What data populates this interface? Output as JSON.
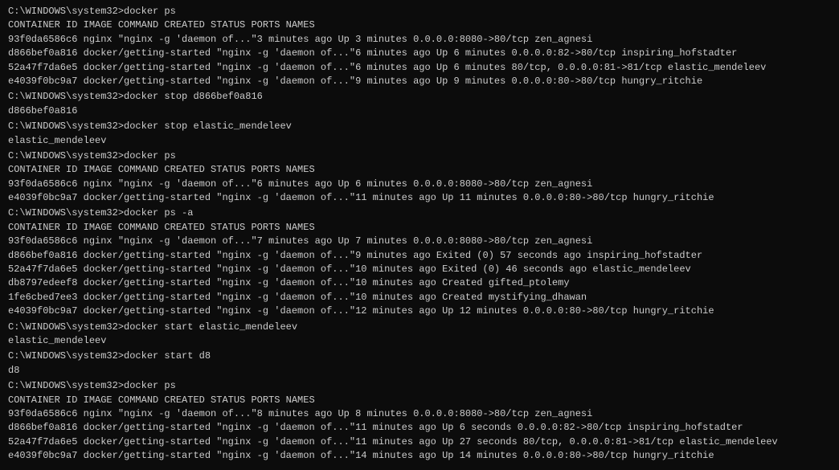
{
  "terminal": {
    "sections": [
      {
        "id": "section1",
        "prompt": "C:\\WINDOWS\\system32>docker ps",
        "table": {
          "headers": [
            "CONTAINER ID",
            "IMAGE",
            "COMMAND",
            "CREATED",
            "STATUS",
            "PORTS",
            "NAMES"
          ],
          "rows": [
            [
              "93f0da6586c6",
              "nginx",
              "\"nginx -g 'daemon of...\"",
              "3 minutes ago",
              "Up 3 minutes",
              "0.0.0.0:8080->80/tcp",
              "zen_agnesi"
            ],
            [
              "d866bef0a816",
              "docker/getting-started",
              "\"nginx -g 'daemon of...\"",
              "6 minutes ago",
              "Up 6 minutes",
              "0.0.0.0:82->80/tcp",
              "inspiring_hofstadter"
            ],
            [
              "52a47f7da6e5",
              "docker/getting-started",
              "\"nginx -g 'daemon of...\"",
              "6 minutes ago",
              "Up 6 minutes",
              "80/tcp, 0.0.0.0:81->81/tcp",
              "elastic_mendeleev"
            ],
            [
              "e4039f0bc9a7",
              "docker/getting-started",
              "\"nginx -g 'daemon of...\"",
              "9 minutes ago",
              "Up 9 minutes",
              "0.0.0.0:80->80/tcp",
              "hungry_ritchie"
            ]
          ]
        }
      },
      {
        "id": "section2",
        "prompt": "C:\\WINDOWS\\system32>docker stop d866bef0a816",
        "output": "d866bef0a816"
      },
      {
        "id": "section3",
        "prompt": "C:\\WINDOWS\\system32>docker stop elastic_mendeleev",
        "output": "elastic_mendeleev"
      },
      {
        "id": "section4",
        "prompt": "C:\\WINDOWS\\system32>docker ps",
        "table": {
          "headers": [
            "CONTAINER ID",
            "IMAGE",
            "COMMAND",
            "CREATED",
            "STATUS",
            "PORTS",
            "NAMES"
          ],
          "rows": [
            [
              "93f0da6586c6",
              "nginx",
              "\"nginx -g 'daemon of...\"",
              "6 minutes ago",
              "Up 6 minutes",
              "0.0.0.0:8080->80/tcp",
              "zen_agnesi"
            ],
            [
              "e4039f0bc9a7",
              "docker/getting-started",
              "\"nginx -g 'daemon of...\"",
              "11 minutes ago",
              "Up 11 minutes",
              "0.0.0.0:80->80/tcp",
              "hungry_ritchie"
            ]
          ]
        }
      },
      {
        "id": "section5",
        "prompt": "C:\\WINDOWS\\system32>docker ps -a",
        "table": {
          "headers": [
            "CONTAINER ID",
            "IMAGE",
            "COMMAND",
            "CREATED",
            "STATUS",
            "PORTS",
            "NAMES"
          ],
          "rows": [
            [
              "93f0da6586c6",
              "nginx",
              "\"nginx -g 'daemon of...\"",
              "7 minutes ago",
              "Up 7 minutes",
              "0.0.0.0:8080->80/tcp",
              "zen_agnesi"
            ],
            [
              "d866bef0a816",
              "docker/getting-started",
              "\"nginx -g 'daemon of...\"",
              "9 minutes ago",
              "Exited (0) 57 seconds ago",
              "",
              "inspiring_hofstadter"
            ],
            [
              "52a47f7da6e5",
              "docker/getting-started",
              "\"nginx -g 'daemon of...\"",
              "10 minutes ago",
              "Exited (0) 46 seconds ago",
              "",
              "elastic_mendeleev"
            ],
            [
              "db8797edeef8",
              "docker/getting-started",
              "\"nginx -g 'daemon of...\"",
              "10 minutes ago",
              "Created",
              "",
              "gifted_ptolemy"
            ],
            [
              "1fe6cbed7ee3",
              "docker/getting-started",
              "\"nginx -g 'daemon of...\"",
              "10 minutes ago",
              "Created",
              "",
              "mystifying_dhawan"
            ],
            [
              "e4039f0bc9a7",
              "docker/getting-started",
              "\"nginx -g 'daemon of...\"",
              "12 minutes ago",
              "Up 12 minutes",
              "0.0.0.0:80->80/tcp",
              "hungry_ritchie"
            ]
          ]
        }
      },
      {
        "id": "section6",
        "prompt": "C:\\WINDOWS\\system32>docker start elastic_mendeleev",
        "output": "elastic_mendeleev"
      },
      {
        "id": "section7",
        "prompt": "C:\\WINDOWS\\system32>docker start d8",
        "output": "d8"
      },
      {
        "id": "section8",
        "prompt": "C:\\WINDOWS\\system32>docker ps",
        "table": {
          "headers": [
            "CONTAINER ID",
            "IMAGE",
            "COMMAND",
            "CREATED",
            "STATUS",
            "PORTS",
            "NAMES"
          ],
          "rows": [
            [
              "93f0da6586c6",
              "nginx",
              "\"nginx -g 'daemon of...\"",
              "8 minutes ago",
              "Up 8 minutes",
              "0.0.0.0:8080->80/tcp",
              "zen_agnesi"
            ],
            [
              "d866bef0a816",
              "docker/getting-started",
              "\"nginx -g 'daemon of...\"",
              "11 minutes ago",
              "Up 6 seconds",
              "0.0.0.0:82->80/tcp",
              "inspiring_hofstadter"
            ],
            [
              "52a47f7da6e5",
              "docker/getting-started",
              "\"nginx -g 'daemon of...\"",
              "11 minutes ago",
              "Up 27 seconds",
              "80/tcp, 0.0.0.0:81->81/tcp",
              "elastic_mendeleev"
            ],
            [
              "e4039f0bc9a7",
              "docker/getting-started",
              "\"nginx -g 'daemon of...\"",
              "14 minutes ago",
              "Up 14 minutes",
              "0.0.0.0:80->80/tcp",
              "hungry_ritchie"
            ]
          ]
        }
      }
    ]
  }
}
